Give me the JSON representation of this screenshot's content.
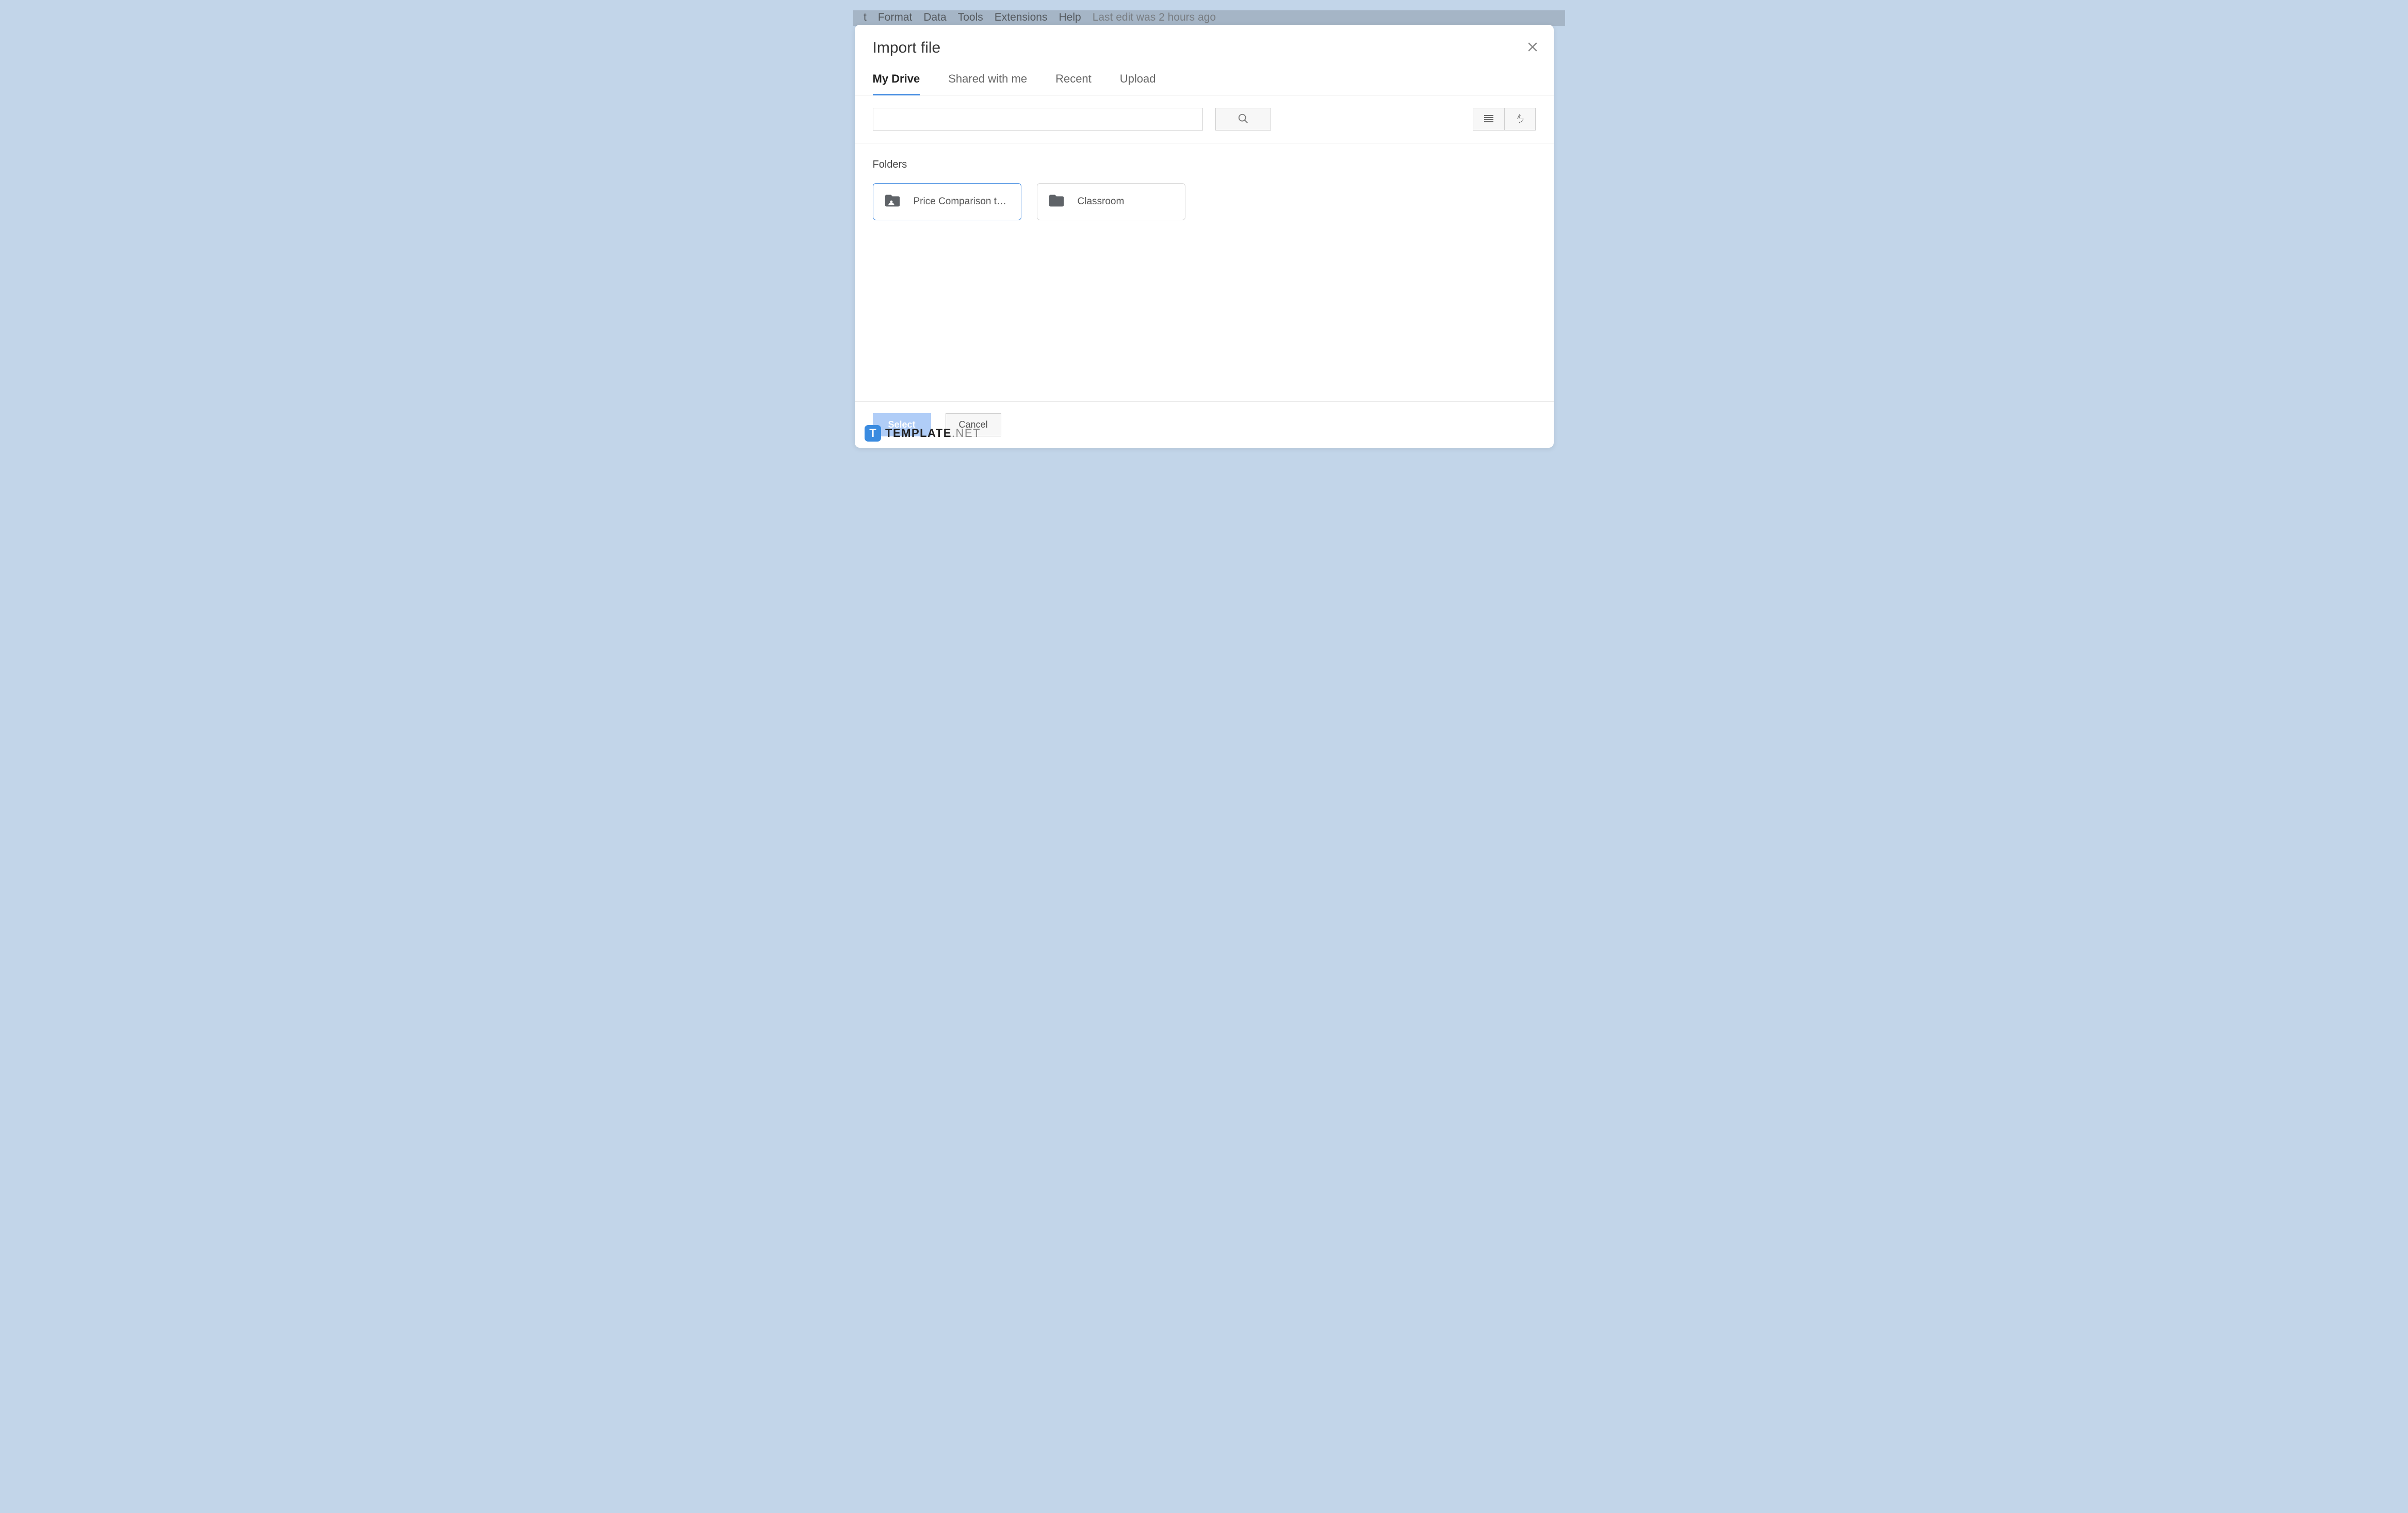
{
  "background": {
    "menu": [
      "t",
      "Format",
      "Data",
      "Tools",
      "Extensions",
      "Help"
    ],
    "status": "Last edit was 2 hours ago"
  },
  "dialog": {
    "title": "Import file",
    "tabs": [
      {
        "label": "My Drive",
        "active": true
      },
      {
        "label": "Shared with me",
        "active": false
      },
      {
        "label": "Recent",
        "active": false
      },
      {
        "label": "Upload",
        "active": false
      }
    ],
    "search": {
      "value": "",
      "placeholder": ""
    },
    "section_label": "Folders",
    "folders": [
      {
        "name": "Price Comparison t…",
        "shared": true,
        "selected": true
      },
      {
        "name": "Classroom",
        "shared": false,
        "selected": false
      }
    ],
    "buttons": {
      "select": "Select",
      "cancel": "Cancel"
    }
  },
  "watermark": {
    "badge": "T",
    "brand": "TEMPLATE",
    "suffix": ".NET"
  }
}
